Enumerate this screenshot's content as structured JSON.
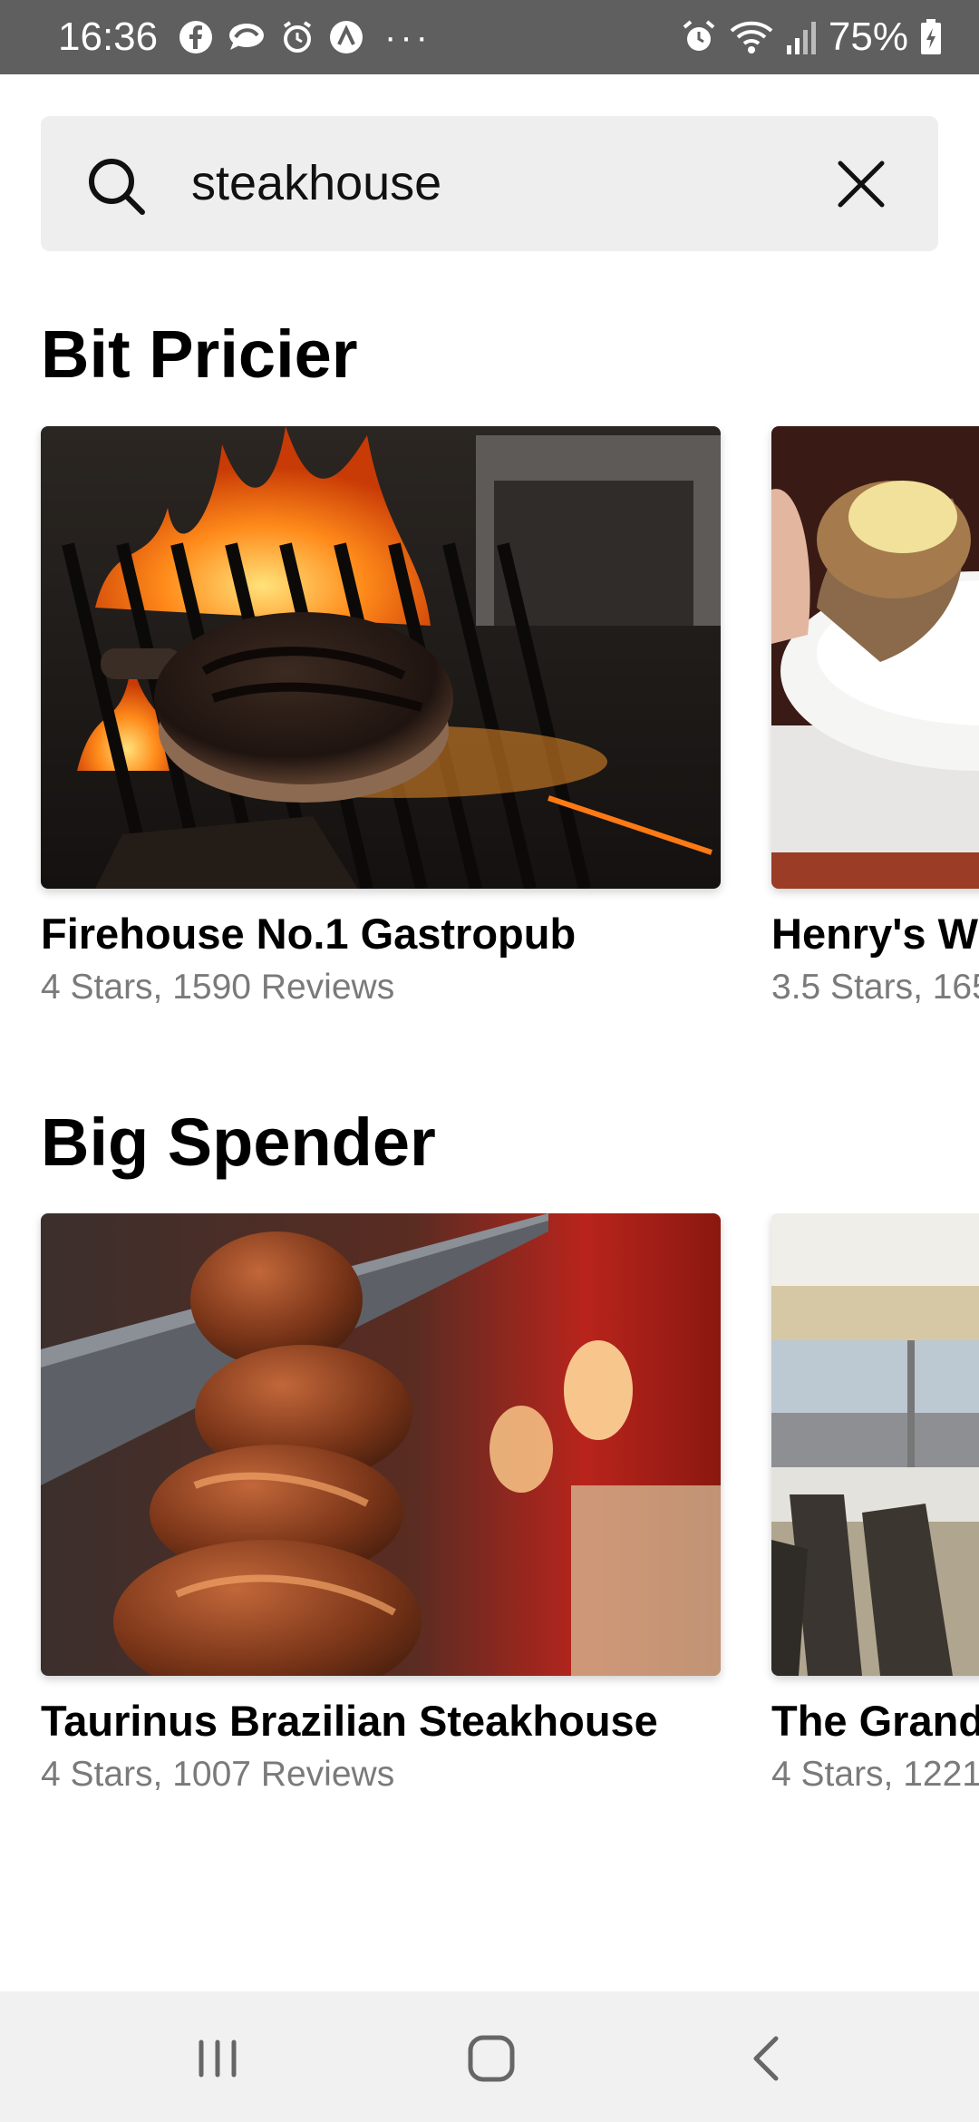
{
  "status_bar": {
    "time": "16:36",
    "battery": "75%",
    "notification_icons": [
      "facebook-icon",
      "messenger-icon",
      "alarm-app-icon",
      "app-icon"
    ],
    "overflow": "···"
  },
  "search": {
    "query": "steakhouse",
    "icon": "search-icon",
    "clear_icon": "close-icon"
  },
  "sections": [
    {
      "title": "Bit Pricier",
      "cards": [
        {
          "name": "Firehouse No.1 Gastropub",
          "meta": "4 Stars, 1590 Reviews"
        },
        {
          "name": "Henry's Wc",
          "meta": "3.5 Stars, 165"
        }
      ]
    },
    {
      "title": "Big Spender",
      "cards": [
        {
          "name": "Taurinus Brazilian Steakhouse",
          "meta": "4 Stars, 1007 Reviews"
        },
        {
          "name": "The Grand",
          "meta": "4 Stars, 1221"
        }
      ]
    }
  ],
  "nav_bar": {
    "icons": [
      "recent-apps-icon",
      "home-icon",
      "back-icon"
    ]
  },
  "colors": {
    "status_bar": "#5f5f5f",
    "search_bg": "#efeeef",
    "meta_text": "#7a7a7a",
    "nav_bar": "#f1f1f1"
  }
}
